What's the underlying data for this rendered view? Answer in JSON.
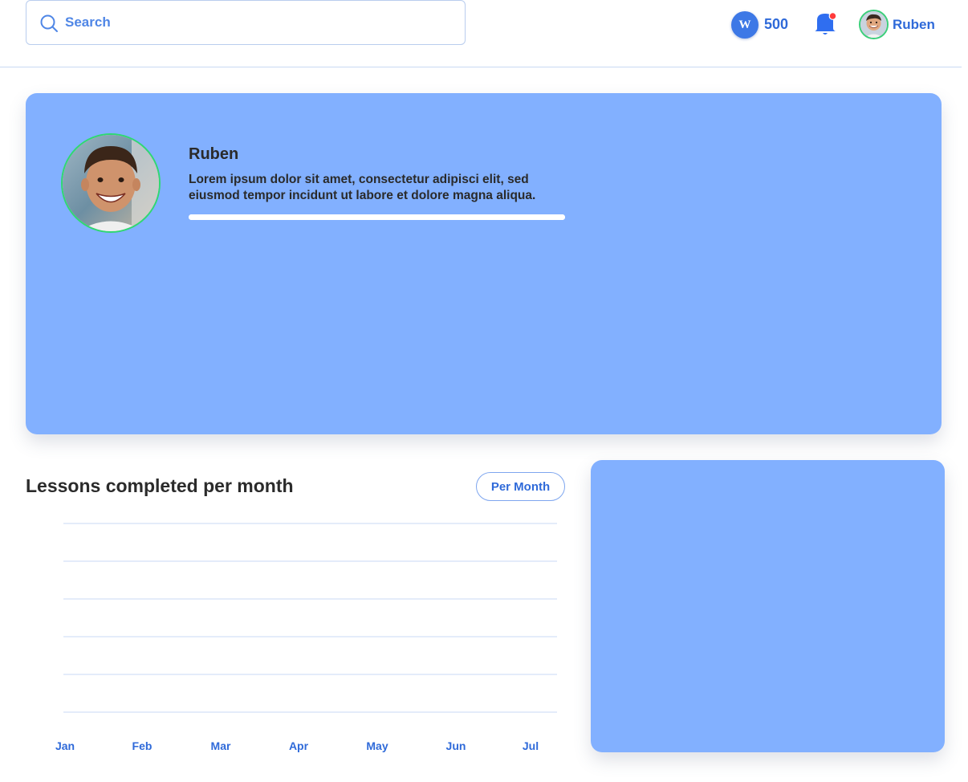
{
  "header": {
    "search": {
      "placeholder": "Search",
      "value": ""
    },
    "coins": {
      "icon_letter": "W",
      "value": "500"
    },
    "notifications": {
      "has_unread": true
    },
    "user": {
      "name": "Ruben"
    }
  },
  "profile": {
    "name": "Ruben",
    "bio_line1": "Lorem ipsum dolor sit amet, consectetur adipisci elit, sed",
    "bio_line2": "eiusmod tempor incidunt ut labore et dolore magna aliqua.",
    "progress": 1.0
  },
  "lessons_chart": {
    "title": "Lessons completed per month",
    "period_button": "Per Month"
  },
  "colors": {
    "card": "#82b0ff",
    "accent": "#2f6ad9",
    "avatar_ring": "#2fd873",
    "notification_dot": "#ff3b3b",
    "gridline": "#d3e1f6"
  },
  "chart_data": {
    "type": "bar",
    "title": "Lessons completed per month",
    "categories": [
      "Jan",
      "Feb",
      "Mar",
      "Apr",
      "May",
      "Jun",
      "Jul"
    ],
    "values": [],
    "grid": true,
    "gridline_count": 6
  }
}
